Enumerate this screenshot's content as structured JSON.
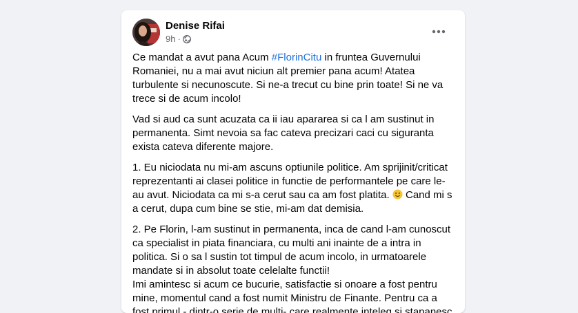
{
  "post": {
    "author": "Denise Rifai",
    "time": "9h",
    "dot": "·",
    "privacy_icon": "globe-icon",
    "more_icon": "more-options-icon",
    "p1_before": "Ce mandat a avut pana Acum ",
    "p1_hashtag": "#FlorinCitu",
    "p1_after": " in fruntea Guvernului Romaniei, nu a mai avut niciun alt premier pana acum! Atatea turbulente si necunoscute. Si ne-a trecut cu bine prin toate!  Si ne va trece si de acum incolo!",
    "p2": "Vad si aud ca sunt acuzata ca ii iau apararea si ca l am sustinut in permanenta. Simt nevoia sa fac cateva precizari caci cu siguranta exista cateva diferente majore.",
    "p3_before": "1. Eu niciodata nu mi-am ascuns optiunile politice. Am sprijinit/criticat reprezentanti ai clasei politice in functie de performantele pe care le-au avut. Niciodata ca mi s-a cerut sau ca am fost platita. ",
    "p3_emoji": "smiling-face-emoji",
    "p3_after": " Cand mi s a cerut, dupa cum bine se stie, mi-am dat demisia.",
    "p4_line1": "2. Pe Florin, l-am sustinut in permanenta, inca de cand l-am cunoscut ca specialist in piata financiara, cu multi ani inainte de a intra in politica. Si o sa l sustin tot timpul de acum incolo, in urmatoarele mandate si in absolut toate celelalte functii!",
    "p4_line2": "Imi amintesc si acum ce bucurie, satisfactie si onoare a fost pentru mine, momentul cand a fost numit Ministru de Finante. Pentru ca a fost primul - dintr-o serie de multi- care realmente inteleg si stapanesc",
    "colors": {
      "link": "#216fdb",
      "text": "#050505",
      "muted": "#65676b",
      "background": "#f0f2f5"
    }
  }
}
